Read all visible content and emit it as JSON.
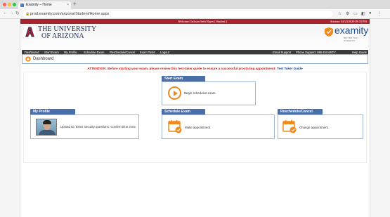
{
  "browser": {
    "tab_title": "Examity – Home",
    "tab_close": "×",
    "new_tab": "+",
    "url": "prod.examity.com/arizona/Student/Home.aspx",
    "back": "←",
    "forward": "→",
    "reload": "↻",
    "lock": "🔒"
  },
  "top_strip": {
    "welcome": "Welcome: Jackson Seth Hayes [ Student ]",
    "datetime": "Arizona: 04/23/2020 08:33 PM"
  },
  "header": {
    "university_line1": "THE UNIVERSITY",
    "university_line2": "OF ARIZONA",
    "brand": "examity",
    "brand_tagline": "BETTER TEST INTEGRITY"
  },
  "nav": {
    "left": [
      "Dashboard",
      "Start Exam",
      "My Profile",
      "Schedule Exam",
      "Reschedule/Cancel",
      "Exam Tools",
      "Logout"
    ],
    "email_support": "Email Support",
    "phone_support": "Phone Support: 855-EXAMITY",
    "help": "Help Guide"
  },
  "dashboard": {
    "title": "Dashboard"
  },
  "attention": {
    "text": "ATTENTION: Before starting your exam, please review this test-taker guide to ensure a successful proctoring appointment:",
    "link": "Test Taker Guide"
  },
  "sections": {
    "start_exam": {
      "title": "Start Exam",
      "desc": "Begin scheduled exam."
    },
    "my_profile": {
      "title": "My Profile",
      "desc": "Upload ID. Enter security questions. Confirm time zone."
    },
    "schedule_exam": {
      "title": "Schedule Exam",
      "desc": "Make appointment."
    },
    "reschedule": {
      "title": "Reschedule/Cancel",
      "desc": "Change appointment."
    }
  },
  "colors": {
    "ua_red": "#a8232e",
    "ua_navy": "#1a2d55",
    "examity_blue": "#1d4e8f",
    "accent_orange": "#f08a1c",
    "section_blue": "#4a6fa8",
    "attention_red": "#cc1d1d"
  },
  "icons": {
    "home": "home-icon",
    "play": "play-icon",
    "calendar": "calendar-check-icon",
    "shield": "examity-shield-icon"
  }
}
